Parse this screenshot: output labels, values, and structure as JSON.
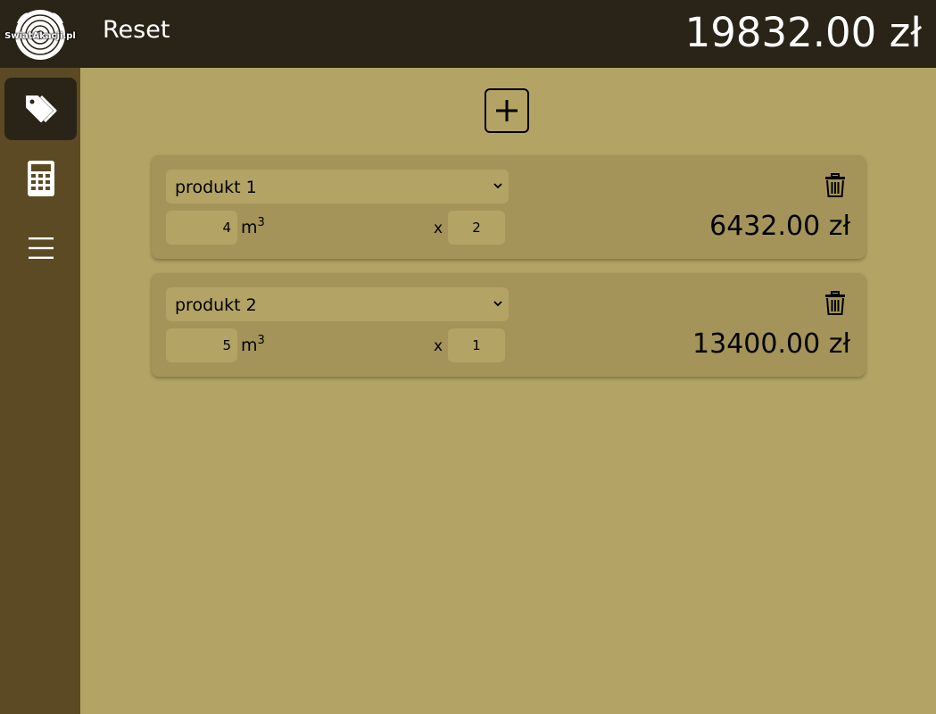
{
  "logo": {
    "text": "SwiatAkacji.pl"
  },
  "header": {
    "reset_label": "Reset",
    "total": "19832.00 zł"
  },
  "items": [
    {
      "product": "produkt 1",
      "quantity": "4",
      "unit": "m",
      "unit_exp": "3",
      "times": "x",
      "multiplier": "2",
      "price": "6432.00 zł"
    },
    {
      "product": "produkt 2",
      "quantity": "5",
      "unit": "m",
      "unit_exp": "3",
      "times": "x",
      "multiplier": "1",
      "price": "13400.00 zł"
    }
  ],
  "nav": {
    "items": [
      "tags-icon",
      "calculator-icon",
      "menu-icon"
    ]
  },
  "colors": {
    "header": "#2a2418",
    "sidebar": "#5b4a24",
    "background": "#b3a465",
    "card": "#a49459"
  }
}
